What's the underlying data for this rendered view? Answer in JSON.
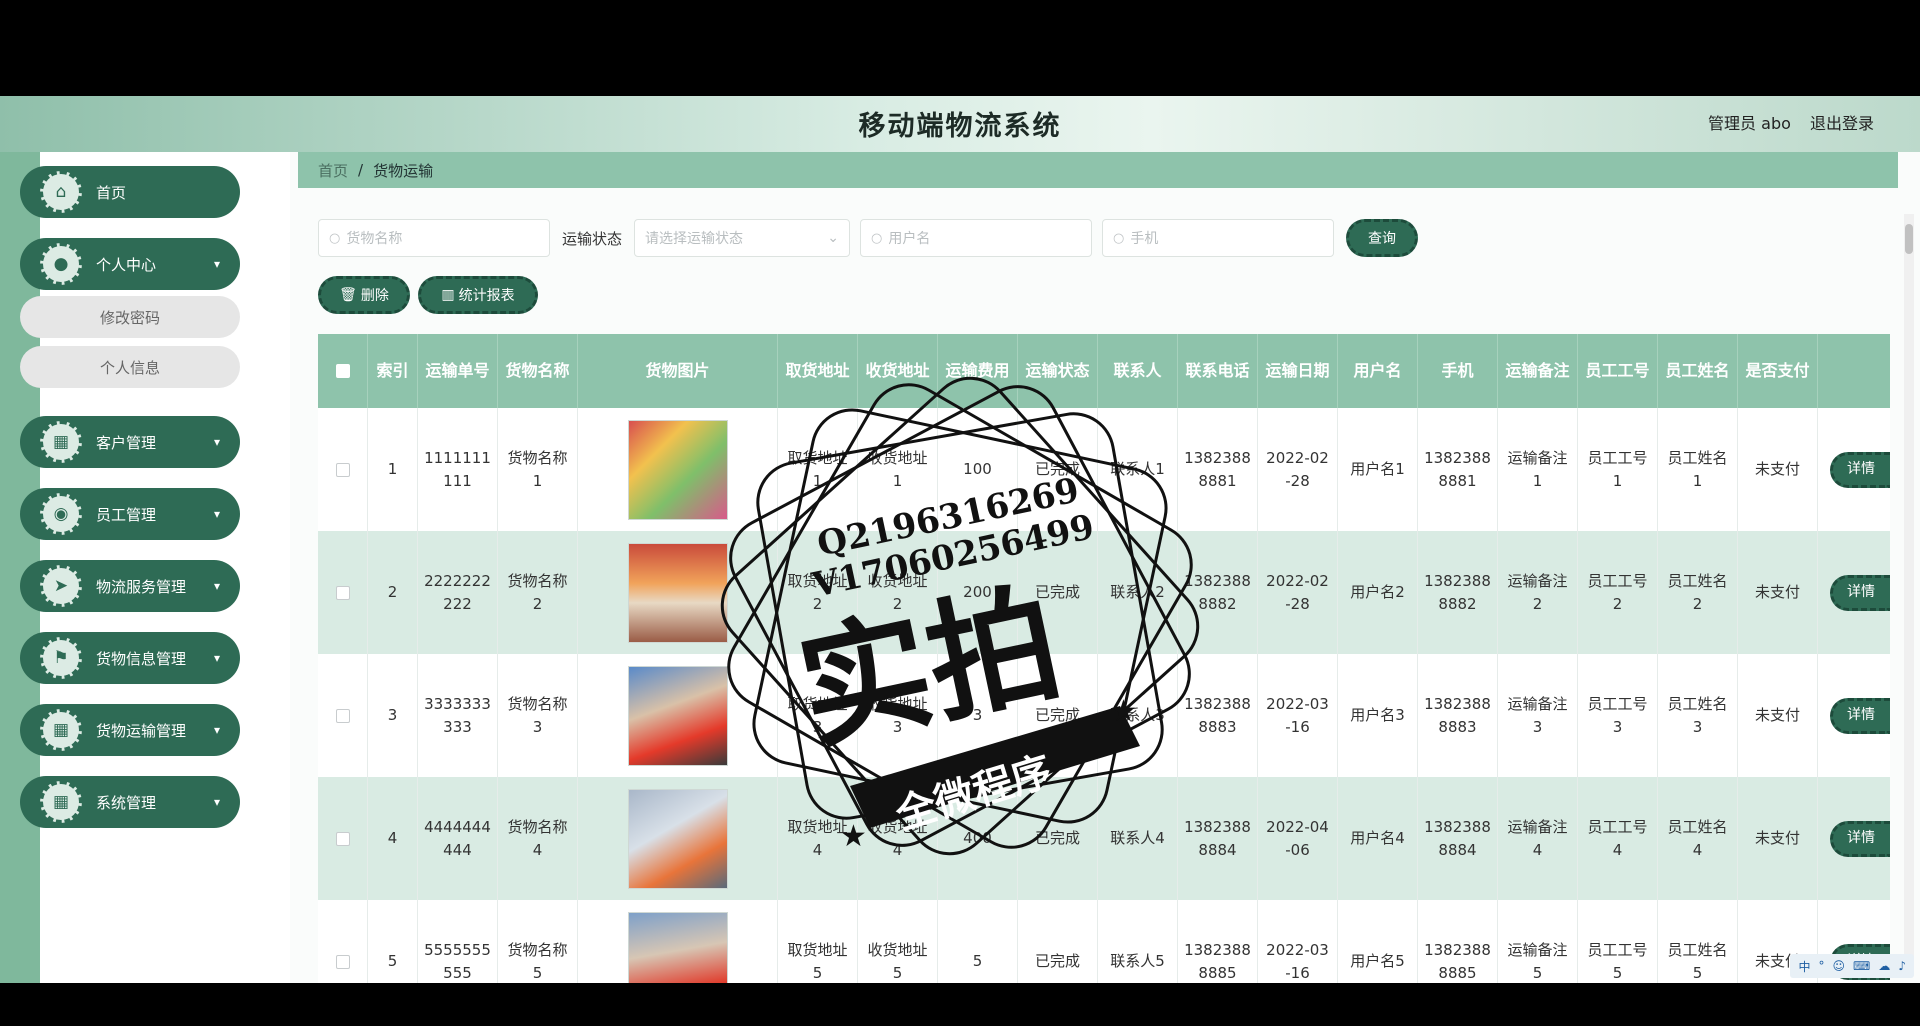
{
  "header": {
    "title": "移动端物流系统",
    "user_label": "管理员 abo",
    "logout": "退出登录"
  },
  "sidebar": {
    "items": [
      {
        "label": "首页",
        "icon": "home-icon"
      },
      {
        "label": "个人中心",
        "icon": "user-icon"
      },
      {
        "label": "客户管理",
        "icon": "grid-icon"
      },
      {
        "label": "员工管理",
        "icon": "location-icon"
      },
      {
        "label": "物流服务管理",
        "icon": "send-icon"
      },
      {
        "label": "货物信息管理",
        "icon": "flag-icon"
      },
      {
        "label": "货物运输管理",
        "icon": "grid-icon"
      },
      {
        "label": "系统管理",
        "icon": "grid-icon"
      }
    ],
    "submenu": [
      "修改密码",
      "个人信息"
    ]
  },
  "breadcrumb": {
    "home": "首页",
    "current": "货物运输"
  },
  "search": {
    "name_placeholder": "货物名称",
    "state_label": "运输状态",
    "state_placeholder": "请选择运输状态",
    "user_placeholder": "用户名",
    "phone_placeholder": "手机",
    "query": "查询"
  },
  "actions": {
    "delete": "删除",
    "report": "统计报表"
  },
  "table": {
    "headers": [
      "索引",
      "运输单号",
      "货物名称",
      "货物图片",
      "取货地址",
      "收货地址",
      "运输费用",
      "运输状态",
      "联系人",
      "联系电话",
      "运输日期",
      "用户名",
      "手机",
      "运输备注",
      "员工工号",
      "员工姓名",
      "是否支付"
    ],
    "rows": [
      {
        "idx": "1",
        "order": "1111111111",
        "name": "货物名称1",
        "pick": "取货地址1",
        "recv": "收货地址1",
        "fee": "100",
        "state": "已完成",
        "contact": "联系人1",
        "tel": "13823888881",
        "date": "2022-02-28",
        "user": "用户名1",
        "phone": "13823888881",
        "note": "运输备注1",
        "empno": "员工工号1",
        "empname": "员工姓名1",
        "paid": "未支付"
      },
      {
        "idx": "2",
        "order": "2222222222",
        "name": "货物名称2",
        "pick": "取货地址2",
        "recv": "收货地址2",
        "fee": "200",
        "state": "已完成",
        "contact": "联系人2",
        "tel": "13823888882",
        "date": "2022-02-28",
        "user": "用户名2",
        "phone": "13823888882",
        "note": "运输备注2",
        "empno": "员工工号2",
        "empname": "员工姓名2",
        "paid": "未支付"
      },
      {
        "idx": "3",
        "order": "3333333333",
        "name": "货物名称3",
        "pick": "取货地址3",
        "recv": "收货地址3",
        "fee": "3",
        "state": "已完成",
        "contact": "联系人3",
        "tel": "13823888883",
        "date": "2022-03-16",
        "user": "用户名3",
        "phone": "13823888883",
        "note": "运输备注3",
        "empno": "员工工号3",
        "empname": "员工姓名3",
        "paid": "未支付"
      },
      {
        "idx": "4",
        "order": "4444444444",
        "name": "货物名称4",
        "pick": "取货地址4",
        "recv": "收货地址4",
        "fee": "400",
        "state": "已完成",
        "contact": "联系人4",
        "tel": "13823888884",
        "date": "2022-04-06",
        "user": "用户名4",
        "phone": "13823888884",
        "note": "运输备注4",
        "empno": "员工工号4",
        "empname": "员工姓名4",
        "paid": "未支付"
      },
      {
        "idx": "5",
        "order": "5555555555",
        "name": "货物名称5",
        "pick": "取货地址5",
        "recv": "收货地址5",
        "fee": "5",
        "state": "已完成",
        "contact": "联系人5",
        "tel": "13823888885",
        "date": "2022-03-16",
        "user": "用户名5",
        "phone": "13823888885",
        "note": "运输备注5",
        "empno": "员工工号5",
        "empname": "员工姓名5",
        "paid": "未支付"
      }
    ],
    "detail_label": "详情"
  },
  "watermark": {
    "line1": "Q2196316269",
    "line2": "V17060256499",
    "big": "实拍",
    "banner": "全微程序"
  },
  "tray": [
    "中",
    "°",
    "☺",
    "⌨",
    "☁",
    "♪"
  ]
}
